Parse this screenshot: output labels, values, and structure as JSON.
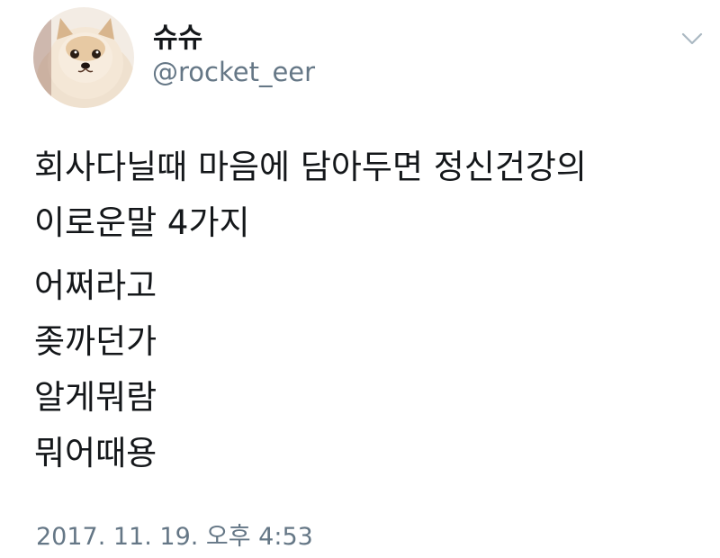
{
  "author": {
    "display_name": "슈슈",
    "handle": "@rocket_eer",
    "avatar_icon": "pomeranian-dog-avatar"
  },
  "menu": {
    "icon": "chevron-down-icon"
  },
  "tweet": {
    "line_1": "회사다닐때 마음에 담아두면 정신건강의",
    "line_2": "이로운말 4가지",
    "items": [
      "어쩌라고",
      "좆까던가",
      "알게뭐람",
      "뭐어때용"
    ]
  },
  "timestamp": "2017. 11. 19. 오후 4:53",
  "colors": {
    "text_primary": "#14171a",
    "text_secondary": "#657786",
    "background": "#ffffff"
  }
}
